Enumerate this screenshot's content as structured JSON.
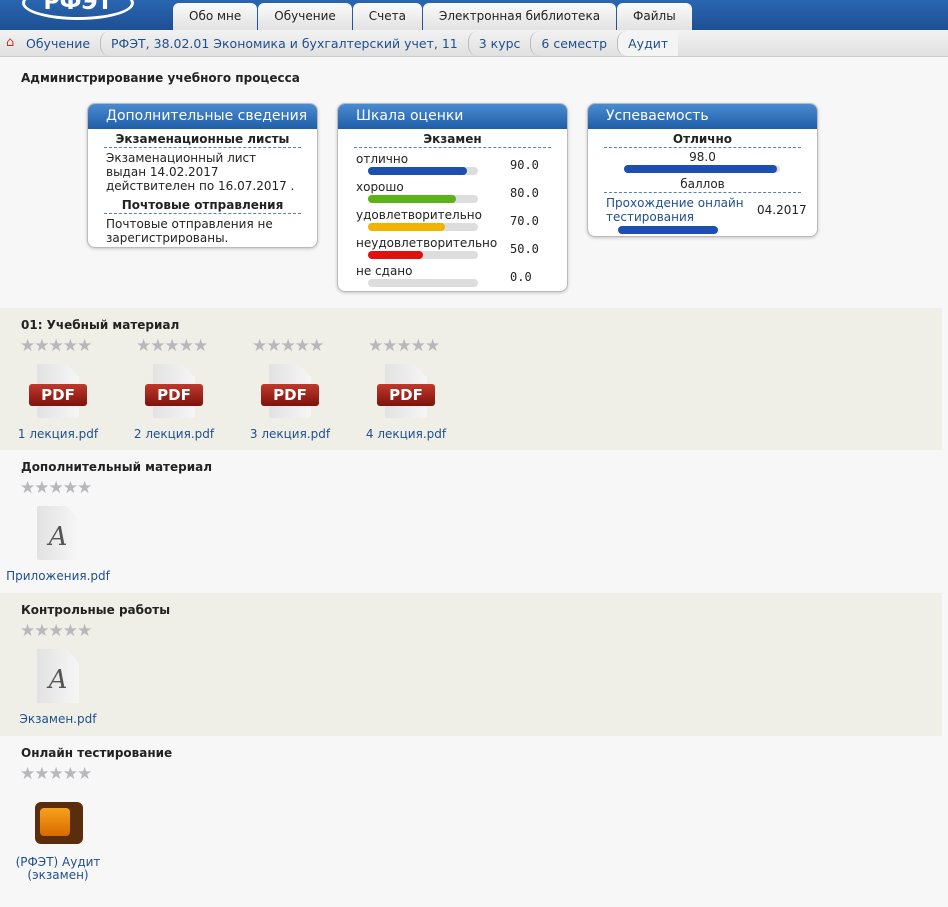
{
  "logo": "РФЭТ",
  "tabs": [
    "Обо мне",
    "Обучение",
    "Счета",
    "Электронная библиотека",
    "Файлы"
  ],
  "breadcrumb": [
    "Обучение",
    "РФЭТ, 38.02.01 Экономика и бухгалтерский учет, 11",
    "3 курс",
    "6 семестр",
    "Аудит"
  ],
  "page_title": "Администрирование учебного процесса",
  "info": {
    "title": "Дополнительные сведения",
    "exam_sheets": "Экзаменационные листы",
    "exam_text": "Экзаменационный лист выдан 14.02.2017 действителен по 16.07.2017 .",
    "mail": "Почтовые отправления",
    "mail_text": "Почтовые отправления не зарегистрированы."
  },
  "scale": {
    "title": "Шкала оценки",
    "sub": "Экзамен",
    "rows": [
      {
        "label": "отлично",
        "value": "90.0",
        "pct": 90,
        "color": "#1c4fb0"
      },
      {
        "label": "хорошо",
        "value": "80.0",
        "pct": 80,
        "color": "#5bb318"
      },
      {
        "label": "удовлетворительно",
        "value": "70.0",
        "pct": 70,
        "color": "#f0b400"
      },
      {
        "label": "неудовлетворительно",
        "value": "50.0",
        "pct": 50,
        "color": "#e01010"
      },
      {
        "label": "не сдано",
        "value": "0.0",
        "pct": 0,
        "color": "#999"
      }
    ]
  },
  "progress": {
    "title": "Успеваемость",
    "grade": "Отлично",
    "score": "98.0",
    "score_pct": 98,
    "unit": "баллов",
    "online_link": "Прохождение онлайн тестирования",
    "online_date": "04.2017"
  },
  "sections": [
    {
      "title": "01: Учебный материал",
      "items": [
        "1 лекция.pdf",
        "2 лекция.pdf",
        "3 лекция.pdf",
        "4 лекция.pdf"
      ]
    },
    {
      "title": "Дополнительный материал",
      "items": [
        "Приложения.pdf"
      ]
    },
    {
      "title": "Контрольные работы",
      "items": [
        "Экзамен.pdf"
      ]
    },
    {
      "title": "Онлайн тестирование",
      "items": [
        "(РФЭТ) Аудит (экзамен)"
      ]
    }
  ],
  "pdf_badge": "PDF",
  "doc_glyph": "A",
  "stars": "★★★★★"
}
